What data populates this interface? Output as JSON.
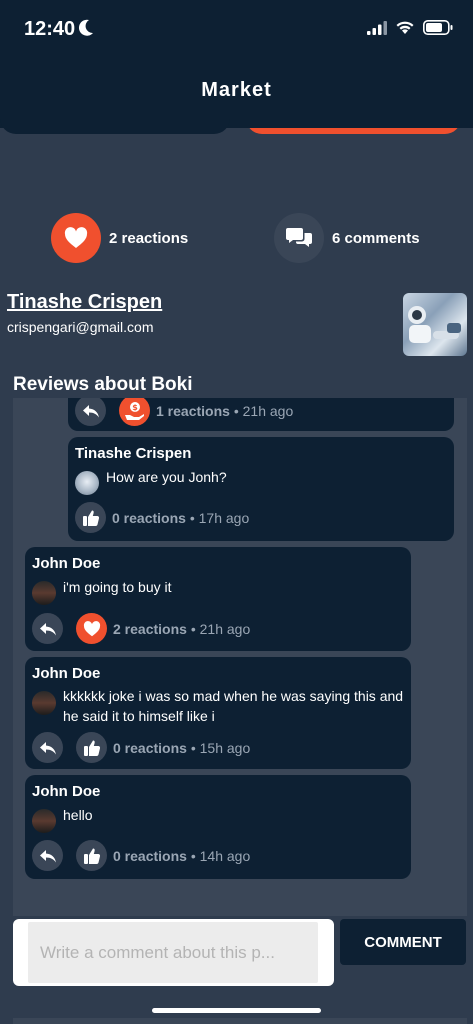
{
  "status_bar": {
    "time": "12:40"
  },
  "header": {
    "title": "Market"
  },
  "stats": {
    "reactions_label": "2 reactions",
    "comments_label": "6 comments"
  },
  "seller": {
    "name": "Tinashe Crispen",
    "email": "crispengari@gmail.com"
  },
  "reviews": {
    "title": "Reviews about Boki",
    "items": [
      {
        "name": "",
        "text": "",
        "reactions": "1 reactions",
        "time": "21h ago",
        "icon": "money-hand-icon"
      },
      {
        "name": "Tinashe Crispen",
        "text": "How are you Jonh?",
        "reactions": "0 reactions",
        "time": "17h ago",
        "icon": "thumbs-up-icon"
      },
      {
        "name": "John Doe",
        "text": "i'm going to buy it",
        "reactions": "2 reactions",
        "time": "21h ago",
        "icon": "heart-icon"
      },
      {
        "name": "John Doe",
        "text": "kkkkkk joke i was so mad when he was saying this and he said it to himself like i",
        "reactions": "0 reactions",
        "time": "15h ago",
        "icon": "thumbs-up-icon"
      },
      {
        "name": "John Doe",
        "text": "hello",
        "reactions": "0 reactions",
        "time": "14h ago",
        "icon": "thumbs-up-icon"
      }
    ]
  },
  "comment": {
    "placeholder": "Write a comment about this p...",
    "button_label": "COMMENT"
  },
  "colors": {
    "accent": "#f0502e",
    "navy": "#0d2033",
    "background": "#2f3c4e"
  }
}
